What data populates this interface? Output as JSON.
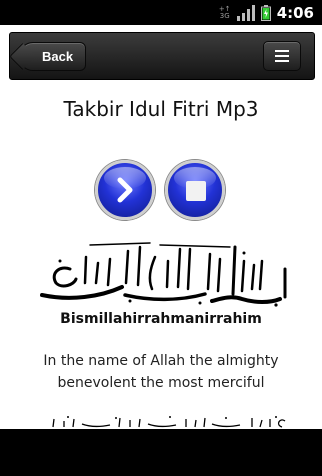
{
  "status_bar": {
    "time": "4:06",
    "network_label_top": "+↑",
    "network_label_bottom": "3G",
    "icons": [
      "network-3g-icon",
      "signal-bars-icon",
      "battery-charging-icon"
    ]
  },
  "header": {
    "back_label": "Back",
    "menu_icon": "hamburger-menu-icon"
  },
  "content": {
    "title": "Takbir Idul Fitri Mp3",
    "play_icon": "play-icon",
    "stop_icon": "stop-icon",
    "calligraphy_icon": "bismillah-calligraphy-image",
    "transliteration": "Bismillahirrahmanirrahim",
    "translation": "In the name of Allah the almighty benevolent the most merciful"
  },
  "colors": {
    "button_blue": "#2232d6",
    "header_dark": "#1e1e1e",
    "battery_green": "#33cc33"
  }
}
